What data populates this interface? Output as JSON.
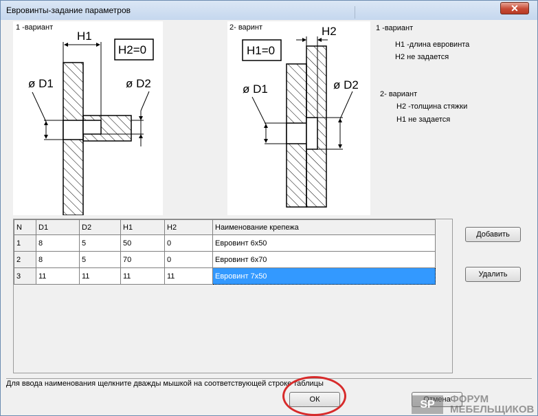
{
  "window": {
    "title": "Евровинты-задание параметров",
    "close_glyph": "✕"
  },
  "figures": {
    "left": {
      "label": "1 -вариант",
      "h1": "H1",
      "h2_box": "H2=0",
      "d1": "ø D1",
      "d2": "ø D2"
    },
    "right": {
      "label": "2- варинт",
      "h2": "H2",
      "h1_box": "H1=0",
      "d1": "ø D1",
      "d2": "ø D2"
    }
  },
  "notes": {
    "v1_title": "1 -вариант",
    "v1_h1": "H1 -длина евровинта",
    "v1_h2": "H2 не задается",
    "v2_title": "2- вариант",
    "v2_h2": "H2 -толщина стяжки",
    "v2_h1": "H1 не задается"
  },
  "table": {
    "columns": [
      "N",
      "D1",
      "D2",
      "H1",
      "H2",
      "Наименование крепежа"
    ],
    "rows": [
      [
        "1",
        "8",
        "5",
        "50",
        "0",
        "Евровинт 6x50"
      ],
      [
        "2",
        "8",
        "5",
        "70",
        "0",
        "Евровинт 6x70"
      ],
      [
        "3",
        "11",
        "11",
        "11",
        "11",
        "Евровинт 7x50"
      ]
    ],
    "selected_row": 3
  },
  "buttons": {
    "add": "Добавить",
    "delete": "Удалить",
    "ok": "ОК",
    "cancel": "Отмена"
  },
  "status_text": "Для ввода наименования  щелкните дважды мышкой на соответствующей строке таблицы",
  "watermark": {
    "logo": "SP",
    "line1": "ФОРУМ",
    "line2": "МЕБЕЛЬЩИКОВ"
  },
  "colors": {
    "selection": "#3399ff",
    "annotation_circle": "#d72b2b",
    "close_button": "#c74a35"
  }
}
